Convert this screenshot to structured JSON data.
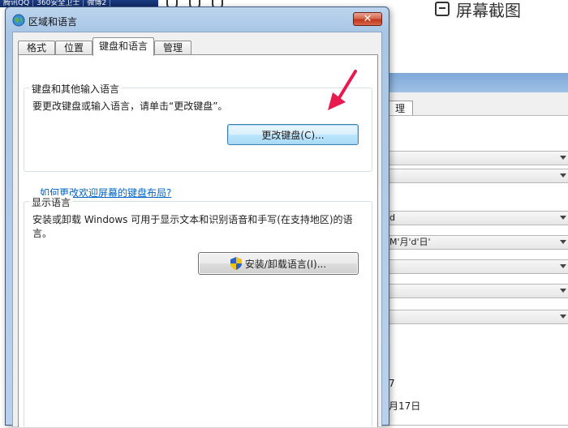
{
  "background": {
    "taskbar_items": [
      "腾讯QQ",
      "360安全卫士",
      "微博2"
    ],
    "screenshot_tool_label": "屏幕截图",
    "tab_fragment": "理",
    "fields": [
      "d",
      "M'月'd'日'"
    ],
    "text_lines": [
      "7",
      "月17日"
    ]
  },
  "dialog": {
    "title": "区域和语言",
    "close_label": "✕",
    "tabs": [
      {
        "label": "格式"
      },
      {
        "label": "位置"
      },
      {
        "label": "键盘和语言",
        "active": true
      },
      {
        "label": "管理"
      }
    ],
    "keyboard_group": {
      "title": "键盘和其他输入语言",
      "description": "要更改键盘或输入语言，请单击“更改键盘”。",
      "button_label": "更改键盘(C)..."
    },
    "keyboard_link": "如何更改欢迎屏幕的键盘布局?",
    "display_group": {
      "title": "显示语言",
      "description_line1": "安装或卸载 Windows 可用于显示文本和识别语音和手写(在支持地区)的语",
      "description_line2": "言。",
      "button_label": "安装/卸载语言(I)..."
    }
  },
  "colors": {
    "annotation_arrow": "#e8194f",
    "link": "#0066cc"
  }
}
